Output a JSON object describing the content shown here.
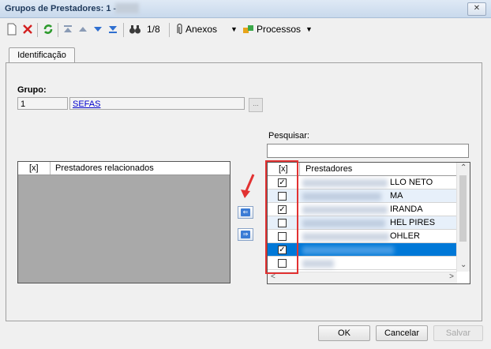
{
  "window": {
    "title": "Grupos de Prestadores: 1 -",
    "close_glyph": "✕"
  },
  "toolbar": {
    "record_position": "1/8",
    "anexos_label": "Anexos",
    "processos_label": "Processos",
    "icons": [
      "new-document-icon",
      "delete-icon",
      "refresh-icon",
      "first-record-icon",
      "previous-record-icon",
      "next-record-icon",
      "last-record-icon",
      "binoculars-icon",
      "paperclip-icon",
      "puzzle-icon"
    ]
  },
  "tabs": [
    {
      "label": "Identificação"
    }
  ],
  "grupo": {
    "label": "Grupo:",
    "code": "1",
    "name": "SEFAS",
    "button": "..."
  },
  "search": {
    "label": "Pesquisar:",
    "value": ""
  },
  "related_grid": {
    "col_check": "[x]",
    "col_name": "Prestadores relacionados",
    "rows": []
  },
  "prestadores_grid": {
    "col_check": "[x]",
    "col_name": "Prestadores",
    "rows": [
      {
        "checked": true,
        "visible_suffix": "LLO NETO",
        "selected": false
      },
      {
        "checked": false,
        "visible_suffix": "MA",
        "selected": false
      },
      {
        "checked": true,
        "visible_suffix": "IRANDA",
        "selected": false
      },
      {
        "checked": false,
        "visible_suffix": "HEL PIRES",
        "selected": false
      },
      {
        "checked": false,
        "visible_suffix": "OHLER",
        "selected": false
      },
      {
        "checked": true,
        "visible_suffix": "",
        "selected": true
      },
      {
        "checked": false,
        "visible_suffix": "",
        "selected": false
      }
    ]
  },
  "buttons": {
    "ok": "OK",
    "cancel": "Cancelar",
    "save": "Salvar"
  },
  "colors": {
    "selection": "#0078d7",
    "annotation_red": "#e23232"
  }
}
